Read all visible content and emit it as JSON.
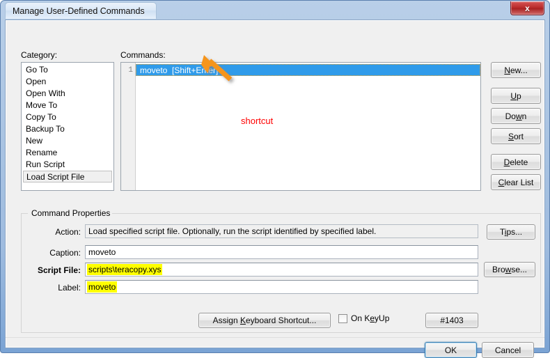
{
  "window": {
    "title": "Manage User-Defined Commands",
    "close_label": "x"
  },
  "category": {
    "label": "Category:",
    "items": [
      {
        "label": "Go To",
        "selected": false
      },
      {
        "label": "Open",
        "selected": false
      },
      {
        "label": "Open With",
        "selected": false
      },
      {
        "label": "Move To",
        "selected": false
      },
      {
        "label": "Copy To",
        "selected": false
      },
      {
        "label": "Backup To",
        "selected": false
      },
      {
        "label": "New",
        "selected": false
      },
      {
        "label": "Rename",
        "selected": false
      },
      {
        "label": "Run Script",
        "selected": false
      },
      {
        "label": "Load Script File",
        "selected": true
      }
    ]
  },
  "commands": {
    "label": "Commands:",
    "rows": [
      {
        "number": "1",
        "text": "moveto  [Shift+Enter]",
        "selected": true
      }
    ]
  },
  "side_buttons": {
    "new": "New...",
    "up": "Up",
    "down": "Down",
    "sort": "Sort",
    "delete": "Delete",
    "clear_list": "Clear List"
  },
  "properties": {
    "group_title": "Command Properties",
    "action_label": "Action:",
    "action_value": "Load specified script file. Optionally, run the script identified by specified label.",
    "caption_label": "Caption:",
    "caption_value": "moveto",
    "script_file_label": "Script File:",
    "script_file_value": "scripts\\teracopy.xys",
    "label_label": "Label:",
    "label_value": "moveto",
    "tips_button": "Tips...",
    "browse_button": "Browse..."
  },
  "shortcut_row": {
    "assign_button": "Assign Keyboard Shortcut...",
    "on_keyup_label": "On KeyUp",
    "on_keyup_checked": false,
    "id_button": "#1403"
  },
  "footer": {
    "ok": "OK",
    "cancel": "Cancel"
  },
  "annotations": {
    "shortcut_note": "shortcut",
    "note_color": "#ff0000",
    "arrow_color": "#f5951e",
    "highlight_color": "#ffff00"
  }
}
